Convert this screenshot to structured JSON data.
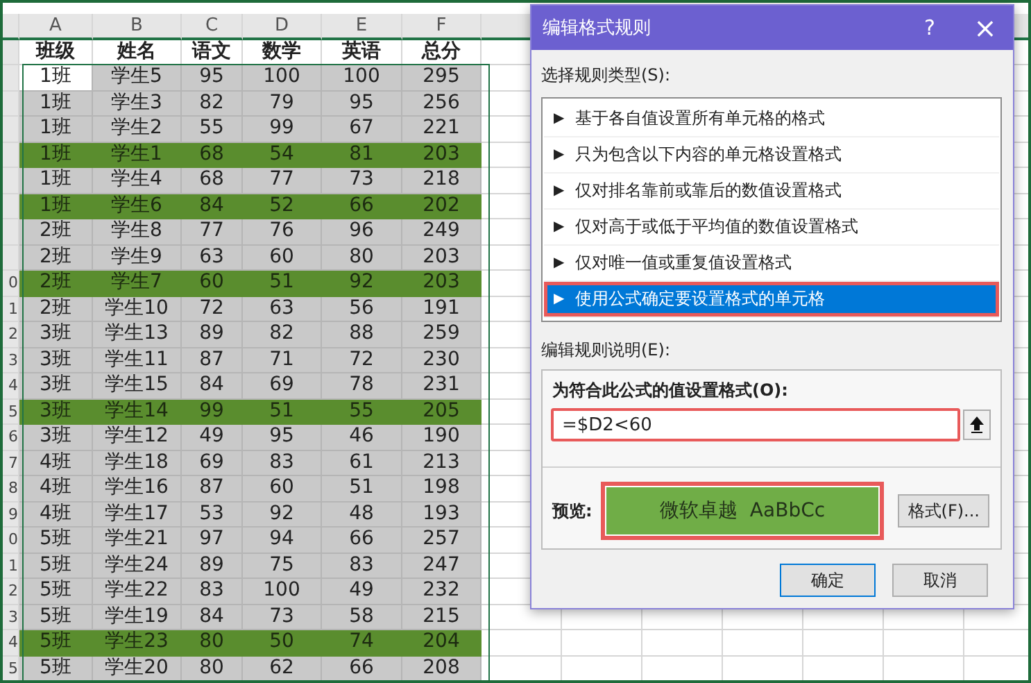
{
  "sheet": {
    "columns": [
      "A",
      "B",
      "C",
      "D",
      "E",
      "F"
    ],
    "header": [
      "班级",
      "姓名",
      "语文",
      "数学",
      "英语",
      "总分"
    ],
    "rows": [
      {
        "cells": [
          "1班",
          "学生5",
          "95",
          "100",
          "100",
          "295"
        ],
        "highlighted": false,
        "active_cell": true
      },
      {
        "cells": [
          "1班",
          "学生3",
          "82",
          "79",
          "95",
          "256"
        ],
        "highlighted": false,
        "active_cell": false
      },
      {
        "cells": [
          "1班",
          "学生2",
          "55",
          "99",
          "67",
          "221"
        ],
        "highlighted": false,
        "active_cell": false
      },
      {
        "cells": [
          "1班",
          "学生1",
          "68",
          "54",
          "81",
          "203"
        ],
        "highlighted": true,
        "active_cell": false
      },
      {
        "cells": [
          "1班",
          "学生4",
          "68",
          "77",
          "73",
          "218"
        ],
        "highlighted": false,
        "active_cell": false
      },
      {
        "cells": [
          "1班",
          "学生6",
          "84",
          "52",
          "66",
          "202"
        ],
        "highlighted": true,
        "active_cell": false
      },
      {
        "cells": [
          "2班",
          "学生8",
          "77",
          "76",
          "96",
          "249"
        ],
        "highlighted": false,
        "active_cell": false
      },
      {
        "cells": [
          "2班",
          "学生9",
          "63",
          "60",
          "80",
          "203"
        ],
        "highlighted": false,
        "active_cell": false
      },
      {
        "row_number": "0",
        "cells": [
          "2班",
          "学生7",
          "60",
          "51",
          "92",
          "203"
        ],
        "highlighted": true,
        "active_cell": false
      },
      {
        "row_number": "1",
        "cells": [
          "2班",
          "学生10",
          "72",
          "63",
          "56",
          "191"
        ],
        "highlighted": false,
        "active_cell": false
      },
      {
        "row_number": "2",
        "cells": [
          "3班",
          "学生13",
          "89",
          "82",
          "88",
          "259"
        ],
        "highlighted": false,
        "active_cell": false
      },
      {
        "row_number": "3",
        "cells": [
          "3班",
          "学生11",
          "87",
          "71",
          "72",
          "230"
        ],
        "highlighted": false,
        "active_cell": false
      },
      {
        "row_number": "4",
        "cells": [
          "3班",
          "学生15",
          "84",
          "69",
          "78",
          "231"
        ],
        "highlighted": false,
        "active_cell": false
      },
      {
        "row_number": "5",
        "cells": [
          "3班",
          "学生14",
          "99",
          "51",
          "55",
          "205"
        ],
        "highlighted": true,
        "active_cell": false
      },
      {
        "row_number": "6",
        "cells": [
          "3班",
          "学生12",
          "49",
          "95",
          "46",
          "190"
        ],
        "highlighted": false,
        "active_cell": false
      },
      {
        "row_number": "7",
        "cells": [
          "4班",
          "学生18",
          "69",
          "83",
          "61",
          "213"
        ],
        "highlighted": false,
        "active_cell": false
      },
      {
        "row_number": "8",
        "cells": [
          "4班",
          "学生16",
          "87",
          "60",
          "51",
          "198"
        ],
        "highlighted": false,
        "active_cell": false
      },
      {
        "row_number": "9",
        "cells": [
          "4班",
          "学生17",
          "53",
          "92",
          "48",
          "193"
        ],
        "highlighted": false,
        "active_cell": false
      },
      {
        "row_number": "0",
        "cells": [
          "5班",
          "学生21",
          "97",
          "94",
          "66",
          "257"
        ],
        "highlighted": false,
        "active_cell": false
      },
      {
        "row_number": "1",
        "cells": [
          "5班",
          "学生24",
          "89",
          "75",
          "83",
          "247"
        ],
        "highlighted": false,
        "active_cell": false
      },
      {
        "row_number": "2",
        "cells": [
          "5班",
          "学生22",
          "83",
          "100",
          "49",
          "232"
        ],
        "highlighted": false,
        "active_cell": false
      },
      {
        "row_number": "3",
        "cells": [
          "5班",
          "学生19",
          "84",
          "73",
          "58",
          "215"
        ],
        "highlighted": false,
        "active_cell": false
      },
      {
        "row_number": "4",
        "cells": [
          "5班",
          "学生23",
          "80",
          "50",
          "74",
          "204"
        ],
        "highlighted": true,
        "active_cell": false
      },
      {
        "row_number": "5",
        "cells": [
          "5班",
          "学生20",
          "80",
          "62",
          "66",
          "208"
        ],
        "highlighted": false,
        "active_cell": false
      }
    ]
  },
  "dialog": {
    "title": "编辑格式规则",
    "help": "?",
    "close": "×",
    "rule_type_label": "选择规则类型(S):",
    "rule_types": [
      {
        "marker": "▶",
        "label": "基于各自值设置所有单元格的格式",
        "selected": false,
        "callout": false
      },
      {
        "marker": "▶",
        "label": "只为包含以下内容的单元格设置格式",
        "selected": false,
        "callout": false
      },
      {
        "marker": "▶",
        "label": "仅对排名靠前或靠后的数值设置格式",
        "selected": false,
        "callout": false
      },
      {
        "marker": "▶",
        "label": "仅对高于或低于平均值的数值设置格式",
        "selected": false,
        "callout": false
      },
      {
        "marker": "▶",
        "label": "仅对唯一值或重复值设置格式",
        "selected": false,
        "callout": false
      },
      {
        "marker": "▶",
        "label": "使用公式确定要设置格式的单元格",
        "selected": true,
        "callout": true
      }
    ],
    "description_label": "编辑规则说明(E):",
    "formula_label": "为符合此公式的值设置格式(O):",
    "formula": {
      "value": "=$D2<60",
      "callout": true
    },
    "preview_label": "预览:",
    "preview": {
      "text": "微软卓越  AaBbCc",
      "callout": true
    },
    "format_button": "格式(F)...",
    "buttons": [
      {
        "kind": "default",
        "label": "确定"
      },
      {
        "kind": "normal",
        "label": "取消"
      }
    ]
  }
}
